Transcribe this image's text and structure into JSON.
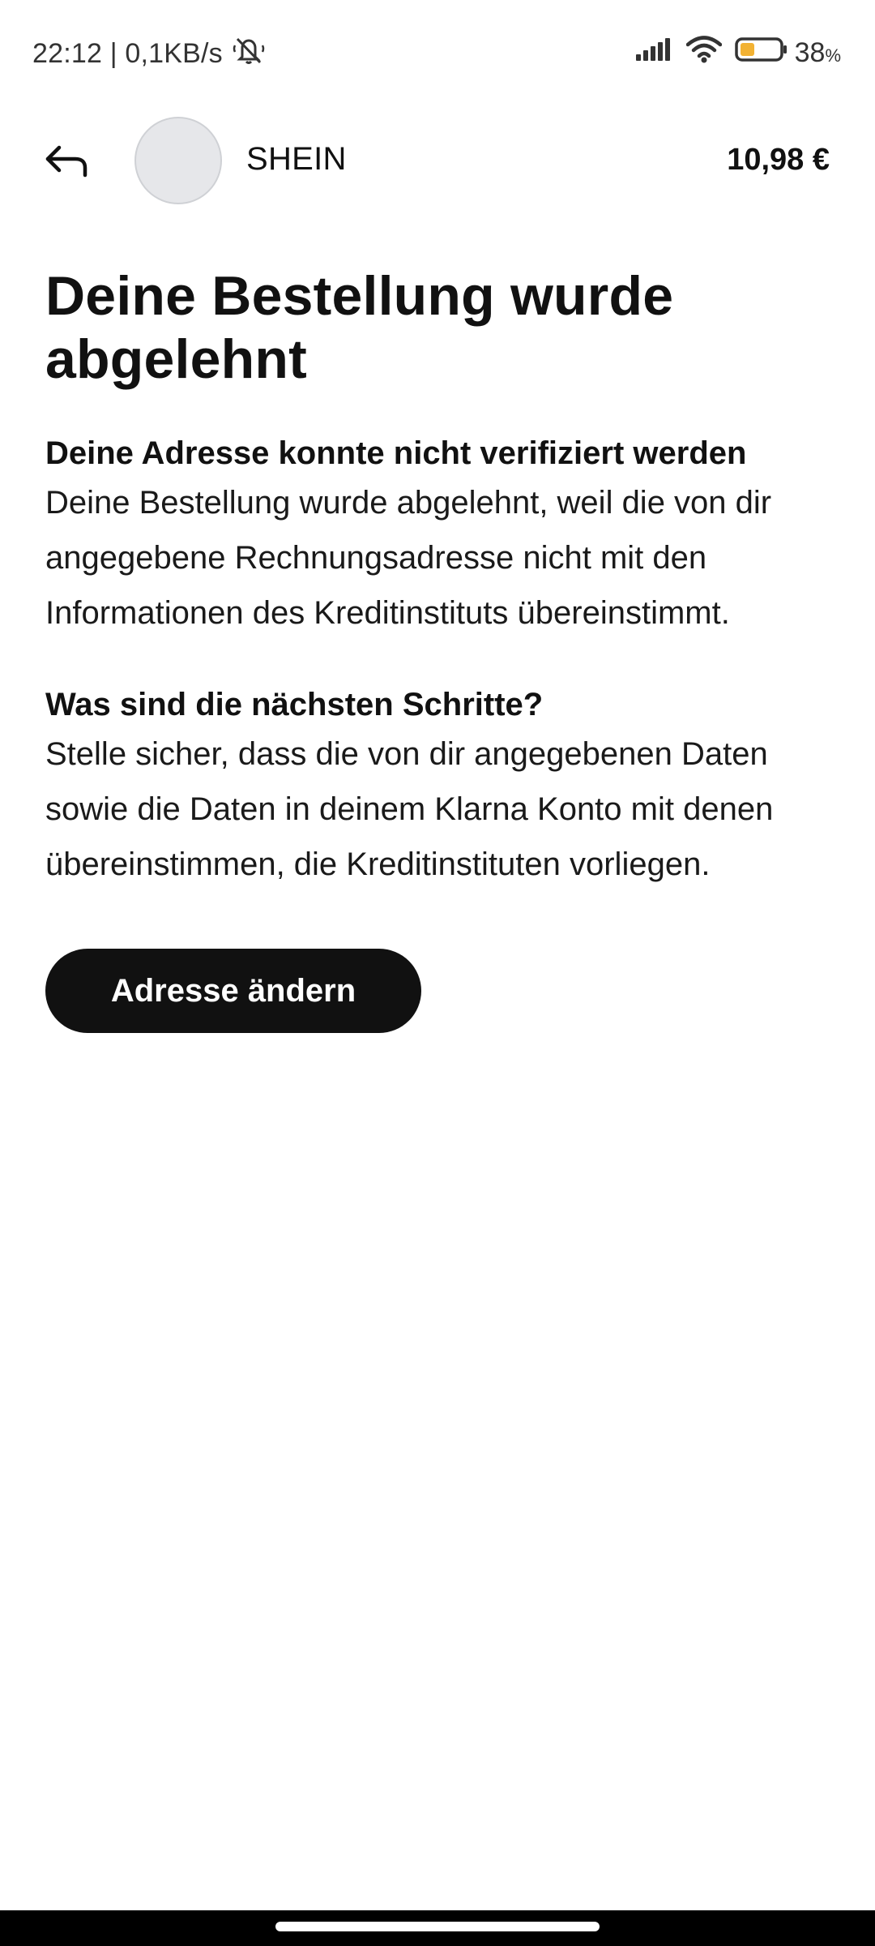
{
  "status_bar": {
    "time_speed": "22:12 | 0,1KB/s",
    "battery_percent": "38",
    "battery_unit": "%",
    "battery_level": 0.38,
    "icons": [
      "mute-icon",
      "signal-icon",
      "wifi-icon",
      "battery-icon"
    ]
  },
  "header": {
    "merchant_name": "SHEIN",
    "amount": "10,98 €"
  },
  "main": {
    "title": "Deine Bestellung wurde abgelehnt",
    "sections": [
      {
        "heading": "Deine Adresse konnte nicht verifiziert werden",
        "body": "Deine Bestellung wurde abgelehnt, weil die von dir angegebene Rechnungsadresse nicht mit den Informationen des Kreditinstituts übereinstimmt."
      },
      {
        "heading": "Was sind die nächsten Schritte?",
        "body": "Stelle sicher, dass die von dir angegebenen Daten sowie die Daten in deinem Klarna Konto mit denen übereinstimmen, die Kreditinstituten vorliegen."
      }
    ],
    "button_label": "Adresse ändern"
  },
  "colors": {
    "button_bg": "#111111",
    "button_text": "#ffffff",
    "battery_fill": "#f2b233",
    "avatar_bg": "#e6e7ea"
  }
}
